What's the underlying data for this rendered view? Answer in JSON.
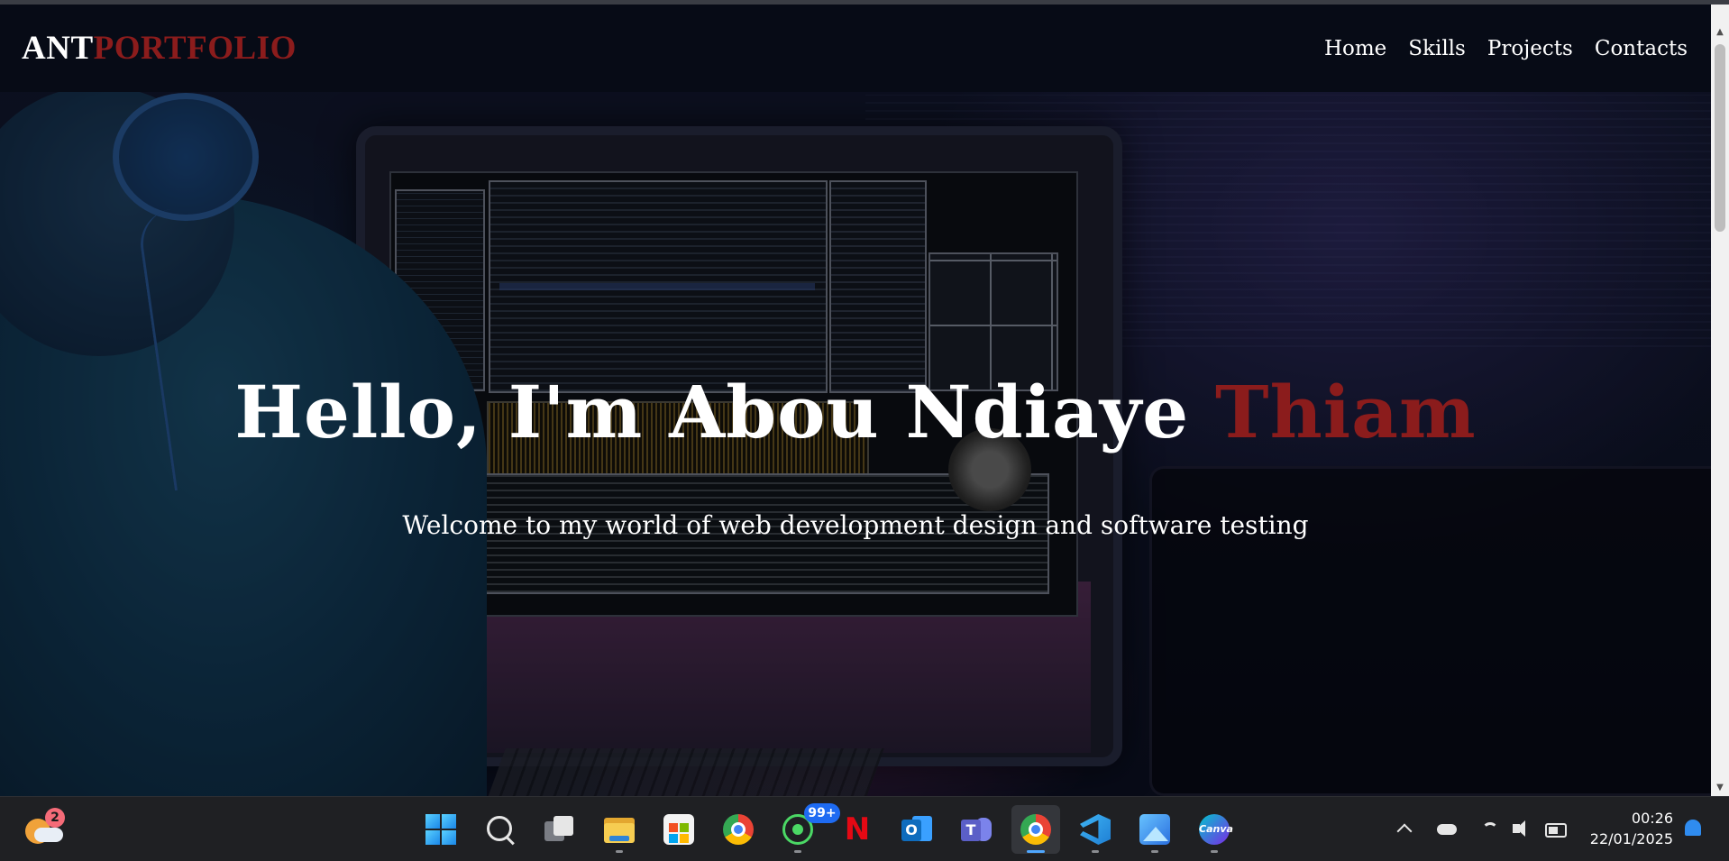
{
  "navbar": {
    "brand_primary": "ANT",
    "brand_accent": "PORTFOLIO",
    "links": [
      {
        "label": "Home"
      },
      {
        "label": "Skills"
      },
      {
        "label": "Projects"
      },
      {
        "label": "Contacts"
      }
    ]
  },
  "hero": {
    "greeting": "Hello, I'm Abou Ndiaye ",
    "accent_name": "Thiam",
    "subtitle": "Welcome to my world of web development design and software testing"
  },
  "colors": {
    "accent": "#8b1c1c",
    "navbar_bg": "#070b16",
    "text": "#ffffff",
    "taskbar_bg": "#1f2023"
  },
  "taskbar": {
    "weather_badge": "2",
    "apps": [
      {
        "icon": "windows-start-icon"
      },
      {
        "icon": "search-icon"
      },
      {
        "icon": "task-view-icon"
      },
      {
        "icon": "file-explorer-icon"
      },
      {
        "icon": "microsoft-store-icon"
      },
      {
        "icon": "chrome-icon"
      },
      {
        "icon": "whatsapp-icon",
        "badge": "99+"
      },
      {
        "icon": "netflix-icon",
        "glyph": "N"
      },
      {
        "icon": "outlook-icon",
        "glyph": "O"
      },
      {
        "icon": "teams-icon",
        "glyph": "T"
      },
      {
        "icon": "chrome-icon-active"
      },
      {
        "icon": "vscode-icon"
      },
      {
        "icon": "photos-icon"
      },
      {
        "icon": "canva-icon",
        "glyph": "Canva"
      }
    ],
    "clock": {
      "time": "00:26",
      "date": "22/01/2025"
    }
  }
}
